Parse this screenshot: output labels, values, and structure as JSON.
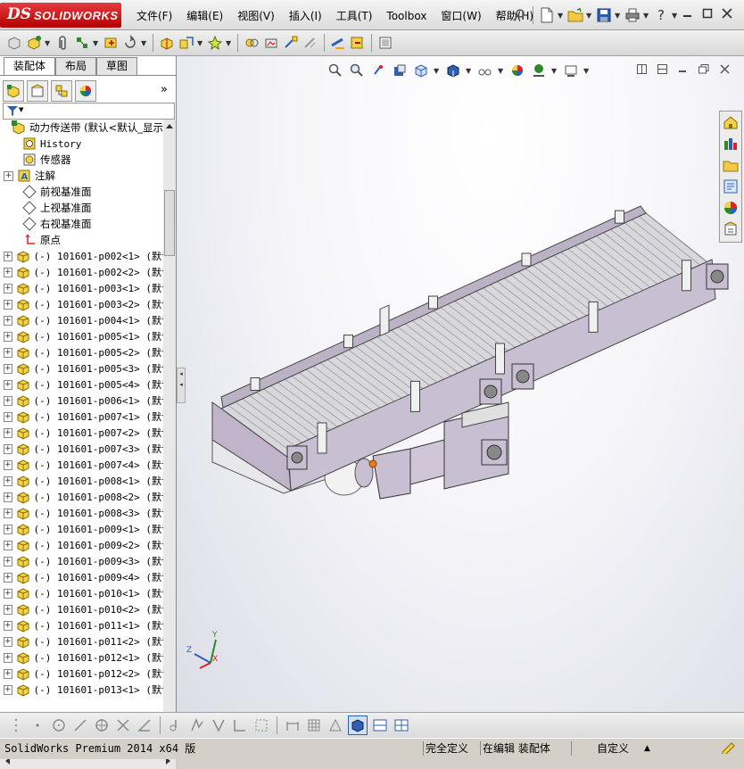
{
  "title_bar": {
    "logo_ds": "DS",
    "logo_text": "SOLIDWORKS",
    "menus": [
      "文件(F)",
      "编辑(E)",
      "视图(V)",
      "插入(I)",
      "工具(T)",
      "Toolbox",
      "窗口(W)",
      "帮助(H)"
    ],
    "help_symbol": "?"
  },
  "left_panel": {
    "tabs": [
      "装配体",
      "布局",
      "草图"
    ],
    "tree": [
      {
        "label": "动力传送带  (默认<默认_显示",
        "icon": "assembly-icon",
        "expand": "none",
        "mono": false
      },
      {
        "label": "History",
        "icon": "history-icon",
        "expand": "none",
        "mono": true
      },
      {
        "label": "传感器",
        "icon": "sensor-icon",
        "expand": "none",
        "mono": false
      },
      {
        "label": "注解",
        "icon": "annotation-icon",
        "expand": "+",
        "mono": false
      },
      {
        "label": "前视基准面",
        "icon": "plane-icon",
        "expand": "none",
        "mono": false
      },
      {
        "label": "上视基准面",
        "icon": "plane-icon",
        "expand": "none",
        "mono": false
      },
      {
        "label": "右视基准面",
        "icon": "plane-icon",
        "expand": "none",
        "mono": false
      },
      {
        "label": "原点",
        "icon": "origin-icon",
        "expand": "none",
        "mono": false
      },
      {
        "label": "(-) 101601-p002<1> (默认",
        "icon": "part-icon",
        "expand": "+",
        "mono": true
      },
      {
        "label": "(-) 101601-p002<2> (默认",
        "icon": "part-icon",
        "expand": "+",
        "mono": true
      },
      {
        "label": "(-) 101601-p003<1> (默认",
        "icon": "part-icon",
        "expand": "+",
        "mono": true
      },
      {
        "label": "(-) 101601-p003<2> (默认",
        "icon": "part-icon",
        "expand": "+",
        "mono": true
      },
      {
        "label": "(-) 101601-p004<1> (默认",
        "icon": "part-icon",
        "expand": "+",
        "mono": true
      },
      {
        "label": "(-) 101601-p005<1> (默认",
        "icon": "part-icon",
        "expand": "+",
        "mono": true
      },
      {
        "label": "(-) 101601-p005<2> (默认",
        "icon": "part-icon",
        "expand": "+",
        "mono": true
      },
      {
        "label": "(-) 101601-p005<3> (默认",
        "icon": "part-icon",
        "expand": "+",
        "mono": true
      },
      {
        "label": "(-) 101601-p005<4> (默认",
        "icon": "part-icon",
        "expand": "+",
        "mono": true
      },
      {
        "label": "(-) 101601-p006<1> (默认",
        "icon": "part-icon",
        "expand": "+",
        "mono": true
      },
      {
        "label": "(-) 101601-p007<1> (默认",
        "icon": "part-icon",
        "expand": "+",
        "mono": true
      },
      {
        "label": "(-) 101601-p007<2> (默认",
        "icon": "part-icon",
        "expand": "+",
        "mono": true
      },
      {
        "label": "(-) 101601-p007<3> (默认",
        "icon": "part-icon",
        "expand": "+",
        "mono": true
      },
      {
        "label": "(-) 101601-p007<4> (默认",
        "icon": "part-icon",
        "expand": "+",
        "mono": true
      },
      {
        "label": "(-) 101601-p008<1> (默认",
        "icon": "part-icon",
        "expand": "+",
        "mono": true
      },
      {
        "label": "(-) 101601-p008<2> (默认",
        "icon": "part-icon",
        "expand": "+",
        "mono": true
      },
      {
        "label": "(-) 101601-p008<3> (默认",
        "icon": "part-icon",
        "expand": "+",
        "mono": true
      },
      {
        "label": "(-) 101601-p009<1> (默认",
        "icon": "part-icon",
        "expand": "+",
        "mono": true
      },
      {
        "label": "(-) 101601-p009<2> (默认",
        "icon": "part-icon",
        "expand": "+",
        "mono": true
      },
      {
        "label": "(-) 101601-p009<3> (默认",
        "icon": "part-icon",
        "expand": "+",
        "mono": true
      },
      {
        "label": "(-) 101601-p009<4> (默认",
        "icon": "part-icon",
        "expand": "+",
        "mono": true
      },
      {
        "label": "(-) 101601-p010<1> (默认",
        "icon": "part-icon",
        "expand": "+",
        "mono": true
      },
      {
        "label": "(-) 101601-p010<2> (默认",
        "icon": "part-icon",
        "expand": "+",
        "mono": true
      },
      {
        "label": "(-) 101601-p011<1> (默认",
        "icon": "part-icon",
        "expand": "+",
        "mono": true
      },
      {
        "label": "(-) 101601-p011<2> (默认",
        "icon": "part-icon",
        "expand": "+",
        "mono": true
      },
      {
        "label": "(-) 101601-p012<1> (默认",
        "icon": "part-icon",
        "expand": "+",
        "mono": true
      },
      {
        "label": "(-) 101601-p012<2> (默认",
        "icon": "part-icon",
        "expand": "+",
        "mono": true
      },
      {
        "label": "(-) 101601-p013<1> (默认",
        "icon": "part-icon",
        "expand": "+",
        "mono": true
      }
    ]
  },
  "viewport": {
    "triad": {
      "x": "X",
      "y": "Y",
      "z": "Z"
    }
  },
  "status_bar": {
    "product": "SolidWorks Premium 2014 x64 版",
    "state": "完全定义",
    "mode": "在编辑 装配体",
    "units": "自定义"
  },
  "colors": {
    "logo_red": "#c81e1e",
    "conveyor_frame": "#c9bfd2",
    "conveyor_belt": "#d8d8dc",
    "conveyor_edge": "#444444"
  }
}
